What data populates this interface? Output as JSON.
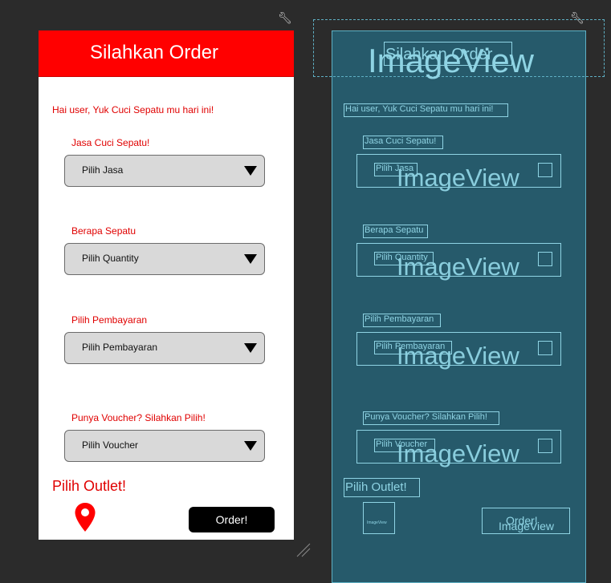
{
  "preview": {
    "header_title": "Silahkan Order",
    "greeting": "Hai user, Yuk Cuci Sepatu mu hari ini!",
    "sections": [
      {
        "label": "Jasa Cuci Sepatu!",
        "spinner": "Pilih Jasa"
      },
      {
        "label": "Berapa Sepatu",
        "spinner": "Pilih Quantity"
      },
      {
        "label": "Pilih Pembayaran",
        "spinner": "Pilih Pembayaran"
      },
      {
        "label": "Punya Voucher? Silahkan Pilih!",
        "spinner": "Pilih Voucher"
      }
    ],
    "outlet_title": "Pilih Outlet!",
    "order_button": "Order!"
  },
  "blueprint": {
    "header_title": "Silahkan Order",
    "imageview_label": "ImageView",
    "imageview_small": "ImageView",
    "greeting": "Hai user, Yuk Cuci Sepatu mu hari ini!",
    "sections": [
      {
        "label": "Jasa Cuci Sepatu!",
        "spinner": "Pilih Jasa"
      },
      {
        "label": "Berapa Sepatu",
        "spinner": "Pilih Quantity"
      },
      {
        "label": "Pilih Pembayaran",
        "spinner": "Pilih Pembayaran"
      },
      {
        "label": "Punya Voucher? Silahkan Pilih!",
        "spinner": "Pilih Voucher"
      }
    ],
    "outlet_title": "Pilih Outlet!",
    "order_button": "Order!"
  },
  "colors": {
    "accent_red": "#ff0000",
    "text_red": "#e00000",
    "spinner_bg": "#d9d9d9",
    "blueprint_bg": "#265a6b",
    "blueprint_line": "#8fd4e4",
    "canvas_bg": "#2b2b2b"
  },
  "icons": [
    "location-pin-icon",
    "dropdown-arrow-icon",
    "wrench-icon",
    "image-placeholder-icon"
  ]
}
